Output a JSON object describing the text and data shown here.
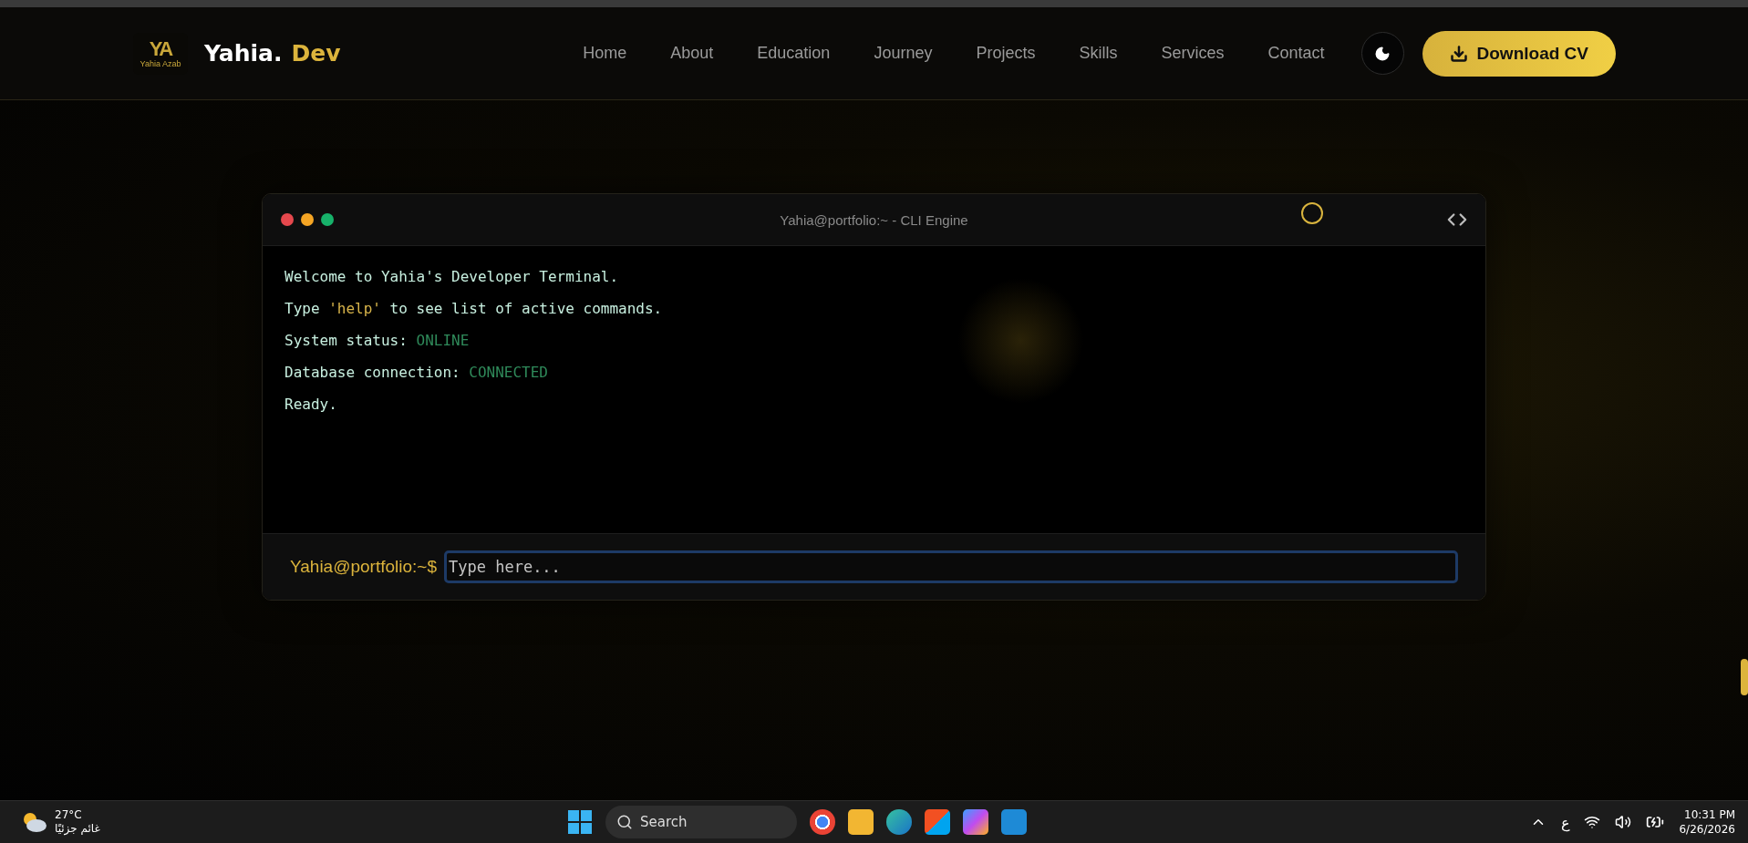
{
  "header": {
    "logo": {
      "mark": "YA",
      "caption": "Yahia Azab"
    },
    "brand": "Yahia.",
    "brand_accent": "Dev",
    "nav": [
      {
        "label": "Home",
        "selected": false
      },
      {
        "label": "About",
        "selected": false
      },
      {
        "label": "Education",
        "selected": false
      },
      {
        "label": "Journey",
        "selected": false
      },
      {
        "label": "Projects",
        "selected": false
      },
      {
        "label": "Skills",
        "selected": false
      },
      {
        "label": "Services",
        "selected": false
      },
      {
        "label": "Contact",
        "selected": false
      }
    ],
    "download_button": "Download CV"
  },
  "terminal": {
    "title": "Yahia@portfolio:~ - CLI Engine",
    "lines": [
      {
        "parts": [
          {
            "text": "Welcome to Yahia's Developer Terminal.",
            "kind": "plain"
          }
        ]
      },
      {
        "parts": [
          {
            "text": "Type ",
            "kind": "plain"
          },
          {
            "text": "'help'",
            "kind": "keyword"
          },
          {
            "text": " to see list of active commands.",
            "kind": "plain"
          }
        ]
      },
      {
        "parts": [
          {
            "text": "System status: ",
            "kind": "plain"
          },
          {
            "text": "ONLINE",
            "kind": "status"
          }
        ]
      },
      {
        "parts": [
          {
            "text": "Database connection: ",
            "kind": "plain"
          },
          {
            "text": "CONNECTED",
            "kind": "status"
          }
        ]
      },
      {
        "parts": [
          {
            "text": "Ready.",
            "kind": "plain"
          }
        ]
      }
    ],
    "prompt": "Yahia@portfolio:~$",
    "input": {
      "placeholder": "Type here..."
    }
  },
  "taskbar": {
    "weather": {
      "temperature": "27°C",
      "condition": "غائم جزئيًا"
    },
    "search": {
      "placeholder": "Search"
    },
    "language": "ع",
    "time": "10:31 PM",
    "date": "6/26/2026"
  }
}
